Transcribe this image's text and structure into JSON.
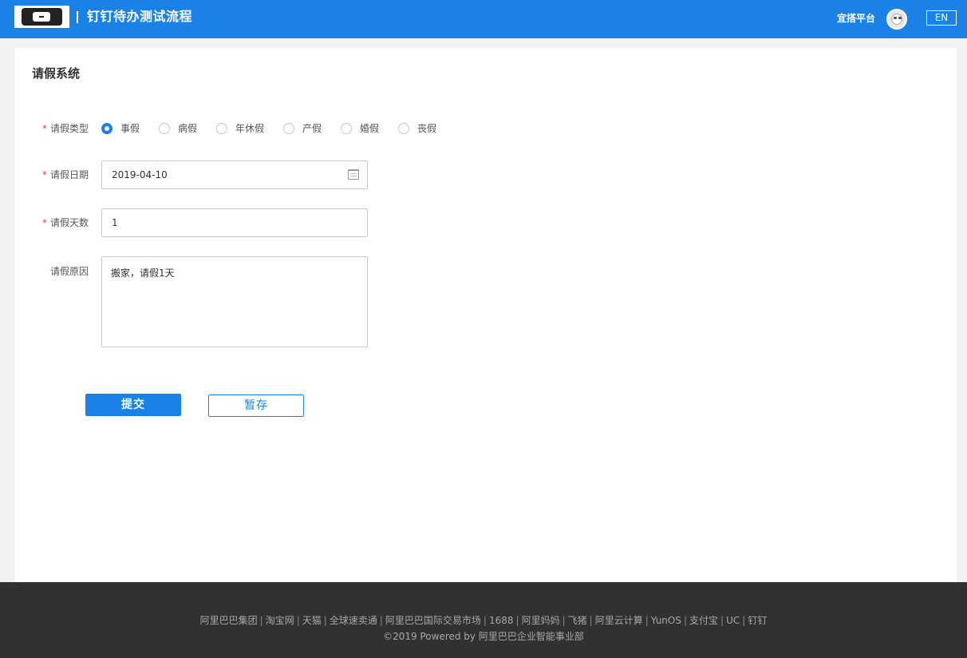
{
  "header": {
    "title": "钉钉待办测试流程",
    "platform": "宜搭平台",
    "lang_button": "EN"
  },
  "card": {
    "title": "请假系统"
  },
  "form": {
    "leave_type": {
      "label": "请假类型",
      "required_mark": "*",
      "options": [
        {
          "label": "事假",
          "checked": true
        },
        {
          "label": "病假",
          "checked": false
        },
        {
          "label": "年休假",
          "checked": false
        },
        {
          "label": "产假",
          "checked": false
        },
        {
          "label": "婚假",
          "checked": false
        },
        {
          "label": "丧假",
          "checked": false
        }
      ]
    },
    "leave_date": {
      "label": "请假日期",
      "required_mark": "*",
      "value": "2019-04-10"
    },
    "leave_days": {
      "label": "请假天数",
      "required_mark": "*",
      "value": "1"
    },
    "leave_reason": {
      "label": "请假原因",
      "value": "搬家，请假1天"
    },
    "submit_label": "提交",
    "save_label": "暂存"
  },
  "footer": {
    "links": [
      "阿里巴巴集团",
      "淘宝网",
      "天猫",
      "全球速卖通",
      "阿里巴巴国际交易市场",
      "1688",
      "阿里妈妈",
      "飞猪",
      "阿里云计算",
      "YunOS",
      "支付宝",
      "UC",
      "钉钉"
    ],
    "separator": "|",
    "copyright": "©2019 Powered by 阿里巴巴企业智能事业部"
  }
}
